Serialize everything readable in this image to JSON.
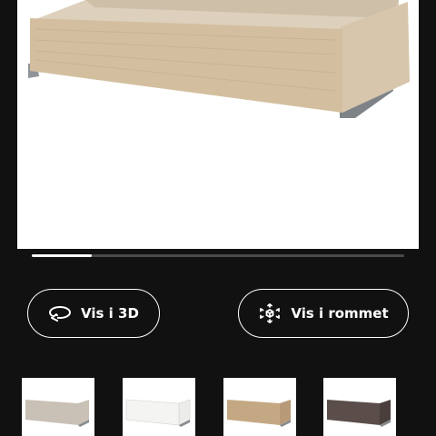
{
  "product": {
    "image_icon": "drawer-image",
    "finish": "white-stained-oak"
  },
  "gallery": {
    "progress": 0.16
  },
  "actions": {
    "view_3d_label": "Vis i 3D",
    "view_3d_icon": "rotate-3d-icon",
    "view_room_label": "Vis i rommet",
    "view_room_icon": "ar-cube-icon"
  },
  "variants": [
    {
      "color": "#c9c0b6",
      "name": "beige"
    },
    {
      "color": "#ececea",
      "name": "white"
    },
    {
      "color": "#b89a78",
      "name": "oak"
    },
    {
      "color": "#5a4d4a",
      "name": "dark-brown"
    }
  ]
}
